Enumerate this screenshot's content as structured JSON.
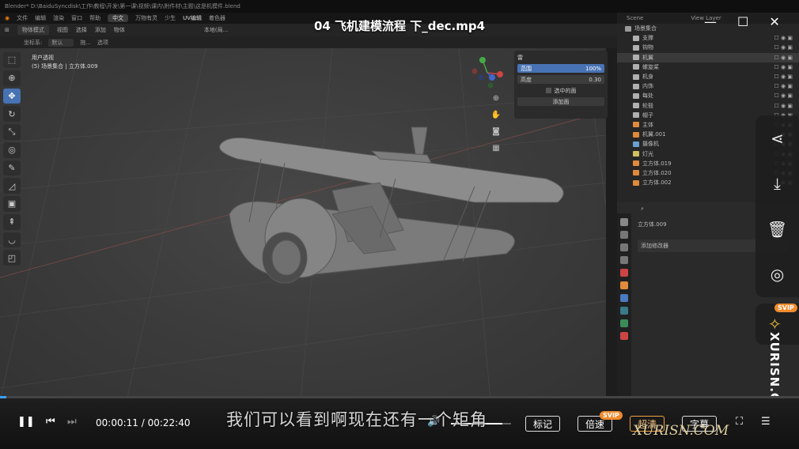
{
  "app": {
    "title_bar": "Blender* D:\\BaiduSyncdisk\\工作\\教程\\开发\\第一课\\视频\\课内\\附件材\\主题\\这是机模件.blend"
  },
  "menu": {
    "items": [
      "文件",
      "编辑",
      "渲染",
      "窗口",
      "帮助"
    ],
    "tabs": [
      "中文",
      "万物有灵",
      "少生",
      "UV编辑",
      "着色器"
    ],
    "active_tab": "中文"
  },
  "header": {
    "mode": "物体模式",
    "items": [
      "视图",
      "选择",
      "添加",
      "物体"
    ],
    "transform_orient": "坐标系:",
    "orient_value": "默认",
    "pivot_label": "拖...",
    "pivot_value": "选项",
    "local": "本地(局...",
    "options": "选项"
  },
  "viewport": {
    "label_line1": "用户透视",
    "label_line2": "(5) 场景集合 | 立方体.009"
  },
  "npanel": {
    "title": "雷",
    "row1_label": "范围",
    "row1_value": "100%",
    "row2_label": "高度",
    "row2_value": "0.30",
    "checkbox_label": "选中的面",
    "button_label": "添加面"
  },
  "outliner": {
    "header_left": "Scene",
    "header_right": "View Layer",
    "root": "场景集合",
    "items": [
      {
        "name": "支撑",
        "color": "#b0b0b0"
      },
      {
        "name": "钩物",
        "color": "#b0b0b0"
      },
      {
        "name": "机翼",
        "color": "#b0b0b0"
      },
      {
        "name": "螺旋桨",
        "color": "#b0b0b0"
      },
      {
        "name": "机身",
        "color": "#b0b0b0"
      },
      {
        "name": "内饰",
        "color": "#b0b0b0"
      },
      {
        "name": "每处",
        "color": "#b0b0b0"
      },
      {
        "name": "轮毂",
        "color": "#b0b0b0"
      },
      {
        "name": "帽子",
        "color": "#b0b0b0"
      },
      {
        "name": "主体",
        "color": "#e08a3c"
      },
      {
        "name": "机翼.001",
        "color": "#e08a3c"
      },
      {
        "name": "摄像机",
        "color": "#6aa0d0"
      },
      {
        "name": "灯光",
        "color": "#d0c060"
      },
      {
        "name": "立方体.019",
        "color": "#e08a3c"
      },
      {
        "name": "立方体.020",
        "color": "#e08a3c"
      },
      {
        "name": "立方体.002",
        "color": "#e08a3c"
      }
    ]
  },
  "properties": {
    "object_name": "立方体.009",
    "modifier_label": "添加修改器"
  },
  "player": {
    "video_title": "04 飞机建模流程 下_dec.mp4",
    "subtitle": "我们可以看到啊现在还有一个矩角",
    "current_time": "00:00:11",
    "total_time": "00:22:40",
    "time_sep": " / ",
    "progress": 0.008,
    "volume": 0.85,
    "btn_mark": "标记",
    "btn_speed": "倍速",
    "btn_quality": "超清",
    "btn_subtitle": "字幕",
    "svip": "SVIP"
  },
  "watermark": {
    "horizontal": "XURISN.COM",
    "vertical": "XURISN.COM"
  },
  "colors": {
    "accent": "#4772b3",
    "svip": "#f08a2c",
    "progress": "#3aa0ff"
  }
}
